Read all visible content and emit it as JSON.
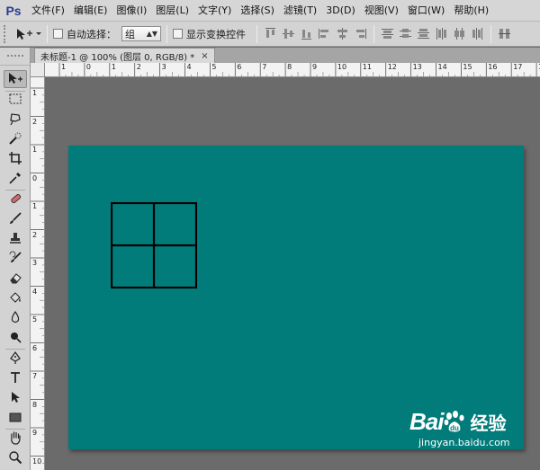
{
  "app": {
    "logo": "Ps"
  },
  "menu": [
    "文件(F)",
    "编辑(E)",
    "图像(I)",
    "图层(L)",
    "文字(Y)",
    "选择(S)",
    "滤镜(T)",
    "3D(D)",
    "视图(V)",
    "窗口(W)",
    "帮助(H)"
  ],
  "options": {
    "auto_select_label": "自动选择：",
    "auto_select_value": "组",
    "show_transform_label": "显示变换控件"
  },
  "document": {
    "tab_title": "未标题-1 @ 100% (图层 0, RGB/8) *",
    "close_glyph": "×",
    "canvas_color": "#017c7a",
    "shape_stroke": "#000000"
  },
  "rulers": {
    "horizontal": [
      "1",
      "0",
      "1",
      "2",
      "3",
      "4",
      "5",
      "6",
      "7",
      "8",
      "9",
      "10",
      "11",
      "12",
      "13",
      "14",
      "15",
      "16",
      "17",
      "18",
      "19"
    ],
    "vertical": [
      "1",
      "2",
      "1",
      "0",
      "1",
      "2",
      "3",
      "4",
      "5",
      "6",
      "7",
      "8",
      "9",
      "10",
      "11"
    ]
  },
  "tools": [
    "move-icon",
    "marquee-icon",
    "lasso-icon",
    "quick-select-icon",
    "crop-icon",
    "eyedropper-icon",
    "healing-icon",
    "brush-icon",
    "clone-stamp-icon",
    "history-brush-icon",
    "eraser-icon",
    "paint-bucket-icon",
    "blur-icon",
    "dodge-icon",
    "pen-icon",
    "type-icon",
    "path-select-icon",
    "rectangle-icon",
    "hand-icon",
    "zoom-icon"
  ],
  "watermark": {
    "brand": "Bai",
    "brand2": "du",
    "suffix": "经验",
    "url": "jingyan.baidu.com"
  }
}
